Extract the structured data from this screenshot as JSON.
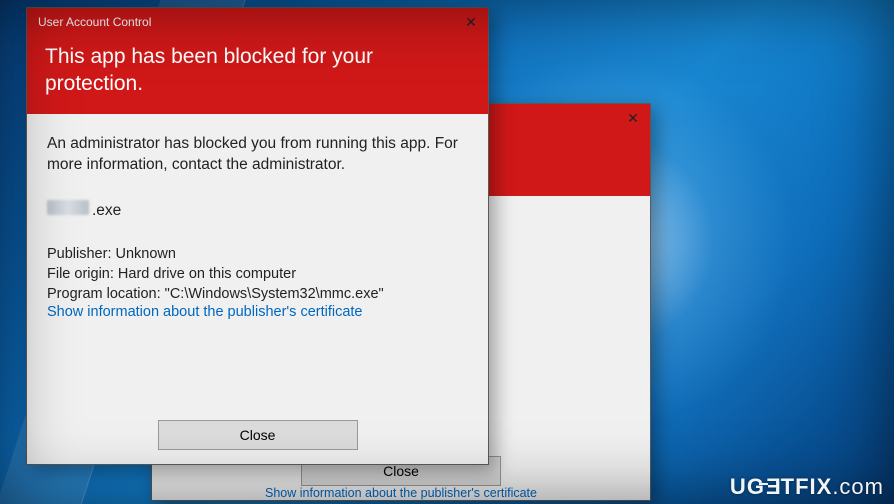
{
  "dialog": {
    "titlebar": "User Account Control",
    "heading": "This app has been blocked for your protection.",
    "message": "An administrator has blocked you from running this app. For more information, contact the administrator.",
    "exe_suffix": ".exe",
    "publisher_label": "Publisher:",
    "publisher_value": "Unknown",
    "origin_label": "File origin:",
    "origin_value": "Hard drive on this computer",
    "location_label": "Program location:",
    "location_value": "\"C:\\Windows\\System32\\mmc.exe\"",
    "cert_link": "Show information about the publisher's certificate",
    "close_btn": "Close"
  },
  "watermark": {
    "brand_u": "U",
    "brand_g": "G",
    "brand_e": "E",
    "brand_t": "T",
    "brand_fix": "FIX",
    "brand_com": ".com"
  }
}
